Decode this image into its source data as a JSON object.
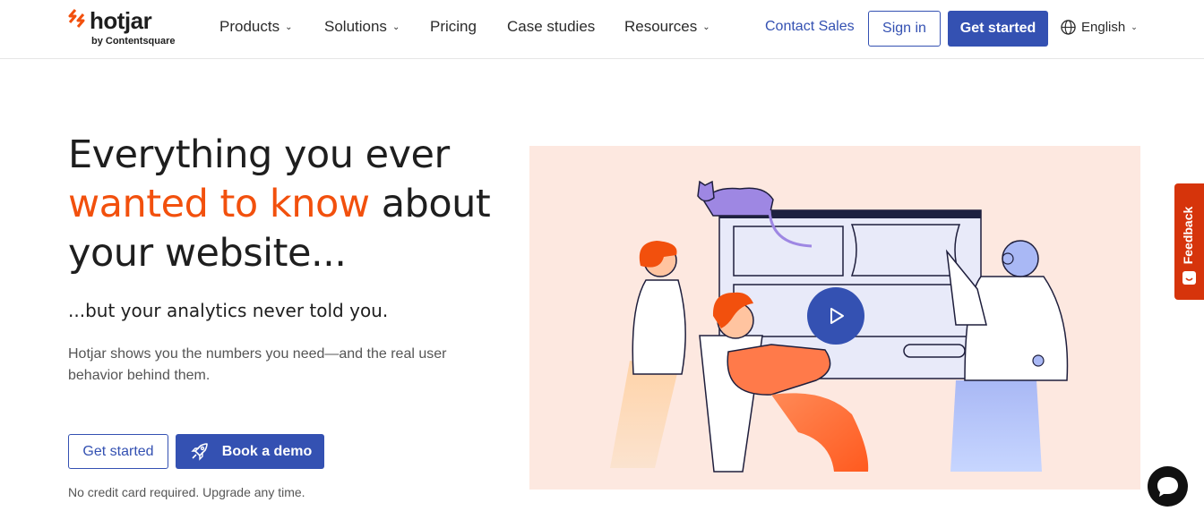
{
  "brand": {
    "name": "hotjar",
    "tagline": "by Contentsquare",
    "color": "#f2500d"
  },
  "nav": {
    "items": [
      {
        "label": "Products",
        "has_dropdown": true
      },
      {
        "label": "Solutions",
        "has_dropdown": true
      },
      {
        "label": "Pricing",
        "has_dropdown": false
      },
      {
        "label": "Case studies",
        "has_dropdown": false
      },
      {
        "label": "Resources",
        "has_dropdown": true
      }
    ],
    "contact_sales": "Contact Sales",
    "sign_in": "Sign in",
    "get_started": "Get started",
    "language": "English",
    "chevron": "⌄"
  },
  "hero": {
    "headline_line1": "Everything you ever",
    "headline_highlight": "wanted to know",
    "headline_rest": " about your website...",
    "subheadline": "...but your analytics never told you.",
    "body": "Hotjar shows you the numbers you need—and the real user behavior behind them.",
    "cta_primary": "Get started",
    "cta_secondary": "Book a demo",
    "fine_print": "No credit card required. Upgrade any time.",
    "illustration_bg": "#fde8e0",
    "accent_color": "#3451b2"
  },
  "feedback_tab": {
    "label": "Feedback"
  }
}
